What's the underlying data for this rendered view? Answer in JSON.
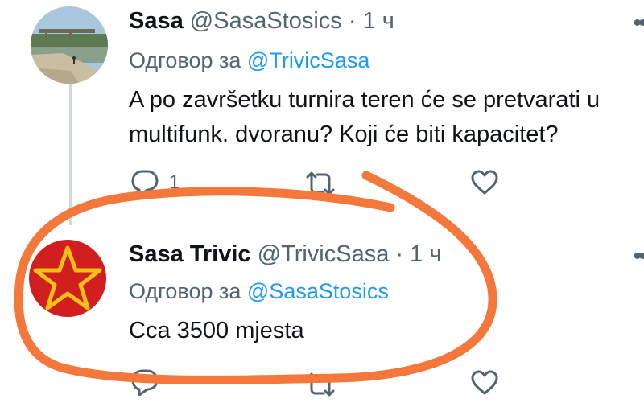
{
  "tweets": [
    {
      "name": "Sasa",
      "handle": "@SasaStosics",
      "time": "· 1 ч",
      "reply_prefix": "Одговор за",
      "reply_to": "@TrivicSasa",
      "text": "A po završetku turnira teren će se pretvarati u multifunk. dvoranu? Koji će biti kapacitet?",
      "reply_count": "1"
    },
    {
      "name": "Sasa Trivic",
      "handle": "@TrivicSasa",
      "time": "· 1 ч",
      "reply_prefix": "Одговор за",
      "reply_to": "@SasaStosics",
      "text": "Cca 3500 mjesta"
    }
  ],
  "icons": {
    "reply": "reply-icon",
    "retweet": "retweet-icon",
    "like": "heart-icon",
    "more": "more-icon"
  },
  "colors": {
    "link": "#1d9bf0",
    "secondary": "#536471",
    "scribble": "#f4773b",
    "star_bg": "#d11f1f",
    "star": "#f2c21a"
  }
}
